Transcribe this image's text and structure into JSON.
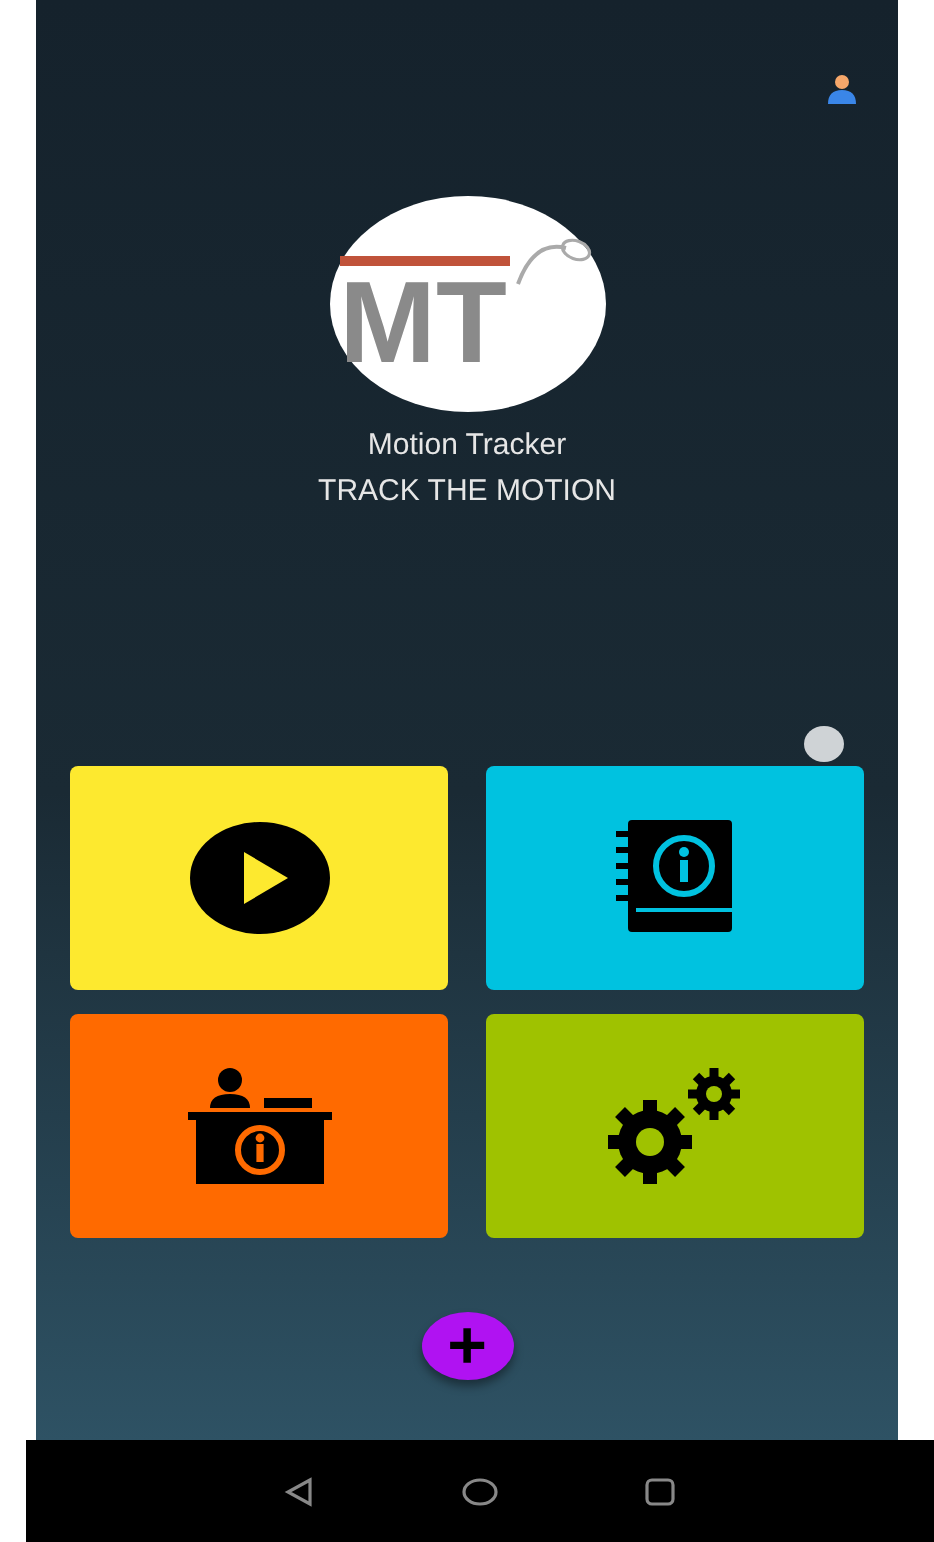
{
  "app": {
    "logo_text": "MT",
    "name": "Motion Tracker",
    "tagline": "TRACK THE MOTION"
  },
  "tiles": [
    {
      "kind": "play",
      "color": "#fde92f"
    },
    {
      "kind": "book",
      "color": "#00c2e0"
    },
    {
      "kind": "desk",
      "color": "#ff6a00"
    },
    {
      "kind": "gears",
      "color": "#9fc200"
    }
  ],
  "fab": {
    "label": "+"
  }
}
